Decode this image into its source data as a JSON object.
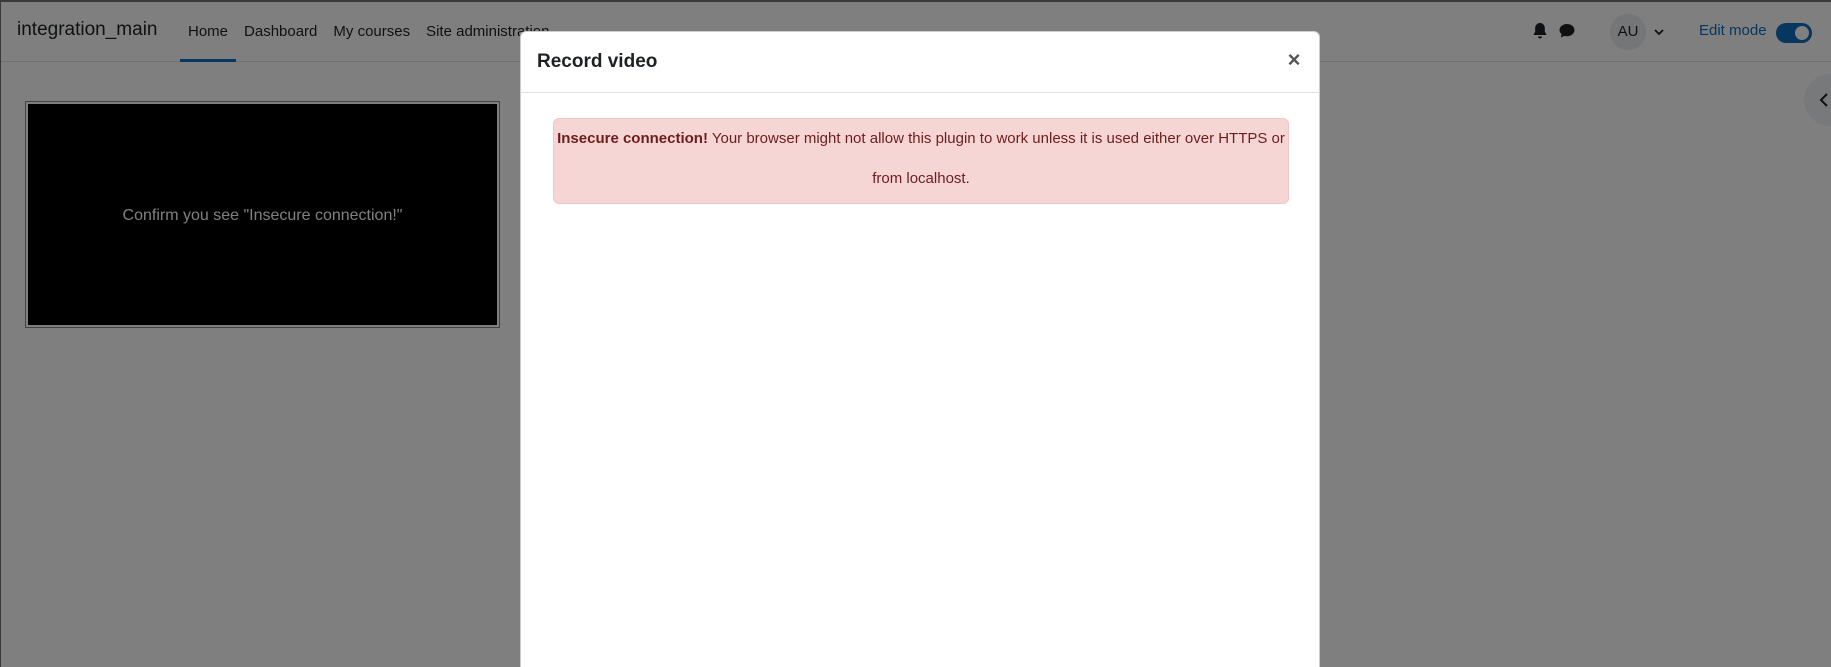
{
  "navbar": {
    "site_name": "integration_main",
    "links": [
      {
        "label": "Home",
        "active": true
      },
      {
        "label": "Dashboard",
        "active": false
      },
      {
        "label": "My courses",
        "active": false
      },
      {
        "label": "Site administration",
        "active": false
      }
    ],
    "icons": [
      "bell-icon",
      "chat-icon",
      "chevron-down-icon"
    ],
    "user_initials": "AU",
    "edit_mode_label": "Edit mode",
    "edit_mode_on": true
  },
  "video_panel": {
    "caption": "Confirm you see \"Insecure connection!\""
  },
  "modal": {
    "title": "Record video",
    "close_label": "×",
    "alert": {
      "strong": "Insecure connection!",
      "message": " Your browser might not allow this plugin to work unless it is used either over HTTPS or from localhost."
    }
  },
  "colors": {
    "accent": "#0f6cbf",
    "alert_bg": "#f6d6d4",
    "alert_text": "#6e1d1c"
  }
}
